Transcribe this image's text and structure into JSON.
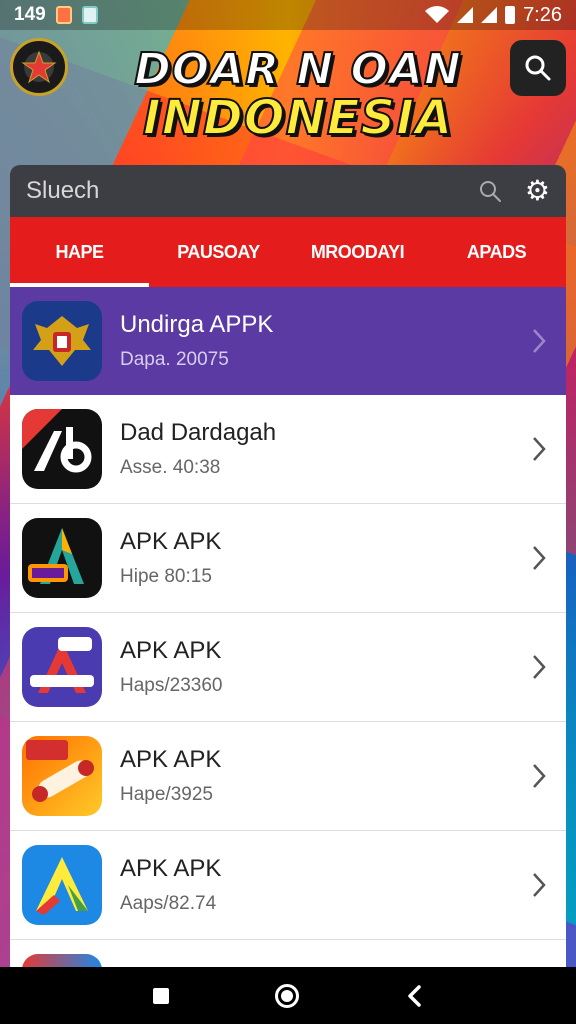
{
  "status_bar": {
    "left_text": "149",
    "time": "7:26",
    "icons": [
      "notification-icon",
      "notification-icon",
      "wifi-icon",
      "signal-icon",
      "signal-icon",
      "battery-icon"
    ]
  },
  "header": {
    "title_line1": "DOAR N OAN",
    "title_line2": "INDONESIA",
    "emblem_icon": "emblem-logo",
    "search_icon": "search-icon"
  },
  "search": {
    "placeholder": "Sluech",
    "search_icon": "search-icon",
    "settings_icon": "gear-icon"
  },
  "tabs": [
    {
      "label": "HAPE",
      "active": true
    },
    {
      "label": "PAUSOAY",
      "active": false
    },
    {
      "label": "MROODAYI",
      "active": false
    },
    {
      "label": "APADS",
      "active": false
    }
  ],
  "apps": [
    {
      "name": "Undirga APPK",
      "sub": "Dapa. 20075",
      "icon": "garuda-emblem-icon",
      "featured": true
    },
    {
      "name": "Dad Dardagah",
      "sub": "Asse. 40:38",
      "icon": "ab-app-icon",
      "featured": false
    },
    {
      "name": "APK APK",
      "sub": "Hipe 80:15",
      "icon": "apk-a-icon",
      "featured": false
    },
    {
      "name": "APK APK",
      "sub": "Haps/23360",
      "icon": "apk-purple-icon",
      "featured": false
    },
    {
      "name": "APK APK",
      "sub": "Hape/3925",
      "icon": "app-scroll-icon",
      "featured": false
    },
    {
      "name": "APK APK",
      "sub": "Aaps/82.74",
      "icon": "apk-blue-icon",
      "featured": false
    }
  ],
  "colors": {
    "tab_bar": "#e51c1c",
    "featured_row": "#5b3aa3",
    "search_bar": "#3d3d44"
  }
}
